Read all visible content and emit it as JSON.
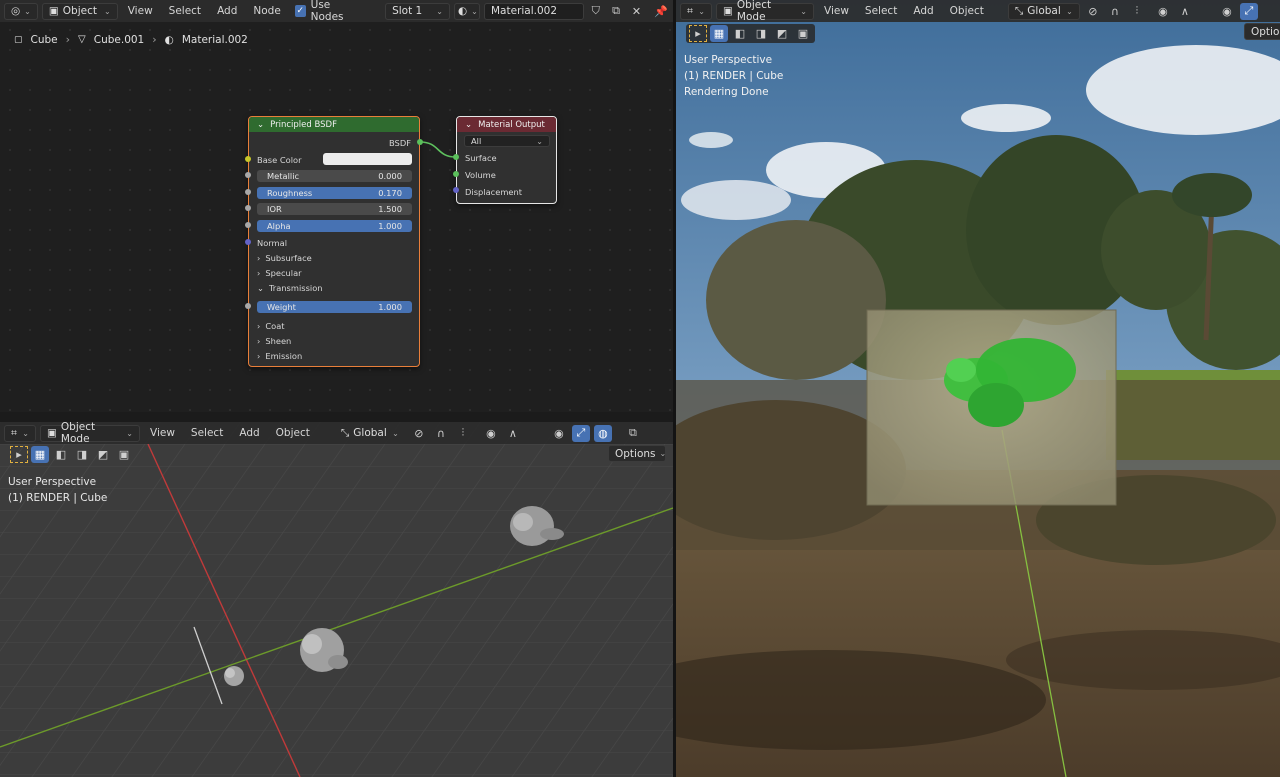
{
  "node_editor": {
    "header": {
      "object_mode": "Object",
      "menus": [
        "View",
        "Select",
        "Add",
        "Node"
      ],
      "use_nodes_label": "Use Nodes",
      "slot": "Slot 1",
      "material_name": "Material.002"
    },
    "breadcrumb": [
      "Cube",
      "Cube.001",
      "Material.002"
    ],
    "principled": {
      "title": "Principled BSDF",
      "output_label": "BSDF",
      "base_color_label": "Base Color",
      "fields": [
        {
          "label": "Metallic",
          "value": "0.000"
        },
        {
          "label": "Roughness",
          "value": "0.170"
        },
        {
          "label": "IOR",
          "value": "1.500"
        },
        {
          "label": "Alpha",
          "value": "1.000"
        }
      ],
      "normal_label": "Normal",
      "panels": [
        "Subsurface",
        "Specular",
        "Transmission"
      ],
      "weight": {
        "label": "Weight",
        "value": "1.000"
      },
      "panels2": [
        "Coat",
        "Sheen",
        "Emission"
      ]
    },
    "output": {
      "title": "Material Output",
      "target": "All",
      "sockets": [
        "Surface",
        "Volume",
        "Displacement"
      ]
    }
  },
  "viewport": {
    "header": {
      "mode": "Object Mode",
      "menus": [
        "View",
        "Select",
        "Add",
        "Object"
      ],
      "orientation": "Global"
    },
    "options_label": "Options",
    "overlay_lines": [
      "User Perspective",
      "(1) RENDER | Cube"
    ]
  },
  "render_view": {
    "header": {
      "mode": "Object Mode",
      "menus": [
        "View",
        "Select",
        "Add",
        "Object"
      ],
      "orientation": "Global",
      "options_label": "Optio"
    },
    "overlay_lines": [
      "User Perspective",
      "(1) RENDER | Cube",
      "Rendering Done"
    ]
  },
  "colors": {
    "accent": "#4772b3",
    "node_principled_header": "#2f6b2f",
    "node_output_header": "#6b2a33",
    "selected_outline": "#e97f3a",
    "socket_shader": "#5bbf5b",
    "socket_value": "#a8a8a8",
    "socket_color": "#c7c729",
    "socket_vector": "#6363c7"
  }
}
